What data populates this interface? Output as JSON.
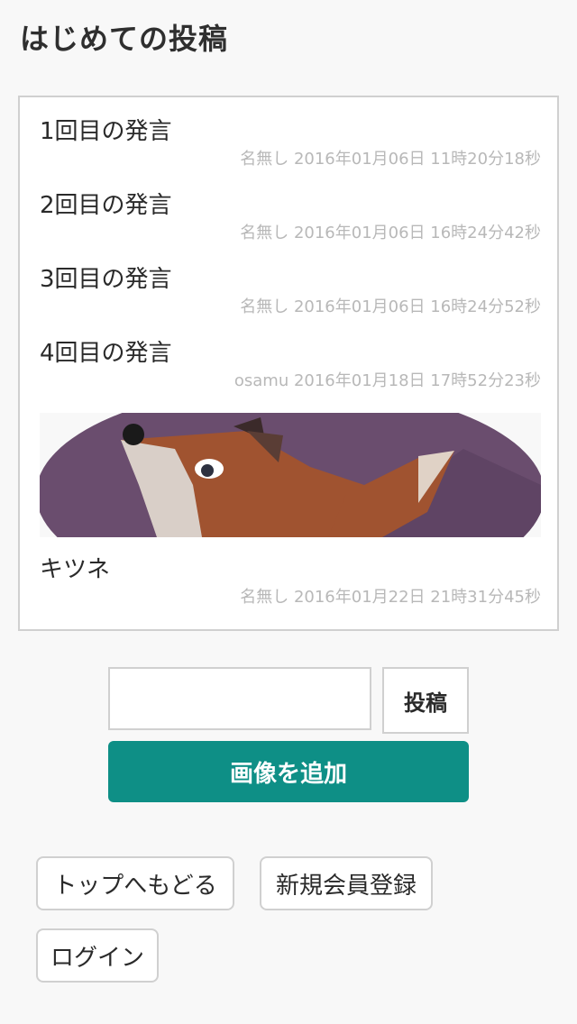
{
  "page": {
    "title": "はじめての投稿"
  },
  "posts": [
    {
      "text": "1回目の発言",
      "meta": "名無し 2016年01月06日 11時20分18秒"
    },
    {
      "text": "2回目の発言",
      "meta": "名無し 2016年01月06日 16時24分42秒"
    },
    {
      "text": "3回目の発言",
      "meta": "名無し 2016年01月06日 16時24分52秒"
    },
    {
      "text": "4回目の発言",
      "meta": "osamu 2016年01月18日 17時52分23秒"
    },
    {
      "text": "キツネ",
      "meta": "名無し 2016年01月22日 21時31分45秒"
    }
  ],
  "composer": {
    "input_value": "",
    "submit_label": "投稿",
    "add_image_label": "画像を追加"
  },
  "nav": {
    "top_label": "トップへもどる",
    "register_label": "新規会員登録",
    "login_label": "ログイン"
  },
  "colors": {
    "accent": "#0e8f86",
    "image_background": "#6a4d6e",
    "fox_orange": "#a05330"
  },
  "icons": {
    "post_image": "fox-illustration"
  }
}
